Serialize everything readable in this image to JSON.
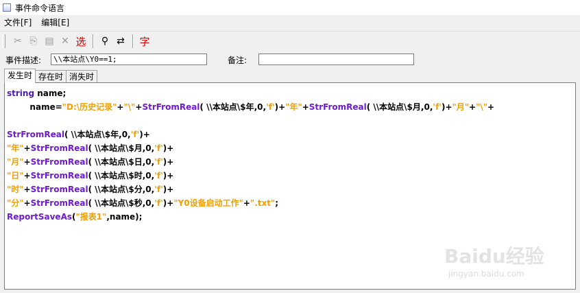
{
  "window": {
    "title": "事件命令语言"
  },
  "menu": {
    "items": [
      "文件[F]",
      "编辑[E]"
    ]
  },
  "toolbar": {
    "buttons": [
      {
        "icon": "cut-icon",
        "glyph": "✂",
        "enabled": false
      },
      {
        "icon": "copy-icon",
        "glyph": "⎘",
        "enabled": false
      },
      {
        "icon": "paste-icon",
        "glyph": "▤",
        "enabled": false
      },
      {
        "icon": "delete-icon",
        "glyph": "✕",
        "enabled": false
      },
      {
        "icon": "select-text",
        "glyph": "选",
        "enabled": true
      },
      {
        "icon": "find-binoculars-icon",
        "glyph": "⚲",
        "enabled": true
      },
      {
        "icon": "replace-icon",
        "glyph": "⇄",
        "enabled": true
      },
      {
        "icon": "font-text",
        "glyph": "字",
        "enabled": true
      }
    ]
  },
  "fields": {
    "event_desc_label": "事件描述:",
    "event_desc_value": "\\\\本站点\\Y0==1;",
    "remark_label": "备注:",
    "remark_value": ""
  },
  "tabs": [
    "发生时",
    "存在时",
    "消失时"
  ],
  "active_tab": 0,
  "code": [
    [
      [
        "kw",
        "string"
      ],
      [
        "id",
        " name;"
      ]
    ],
    [
      [
        "id",
        "        name="
      ],
      [
        "str",
        "\"D:\\历史记录\""
      ],
      [
        "op",
        "+"
      ],
      [
        "str",
        "\"\\\""
      ],
      [
        "op",
        "+"
      ],
      [
        "fn",
        "StrFromReal"
      ],
      [
        "id",
        "( \\\\本站点\\$年,0,"
      ],
      [
        "str",
        "'f'"
      ],
      [
        "id",
        ")+"
      ],
      [
        "str",
        "\"年\""
      ],
      [
        "op",
        "+"
      ],
      [
        "fn",
        "StrFromReal"
      ],
      [
        "id",
        "( \\\\本站点\\$月,0,"
      ],
      [
        "str",
        "'f'"
      ],
      [
        "id",
        ")+"
      ],
      [
        "str",
        "\"月\""
      ],
      [
        "op",
        "+"
      ],
      [
        "str",
        "\"\\\""
      ],
      [
        "op",
        "+"
      ]
    ],
    [],
    [
      [
        "fn",
        "StrFromReal"
      ],
      [
        "id",
        "( \\\\本站点\\$年,0,"
      ],
      [
        "str",
        "'f'"
      ],
      [
        "id",
        ")+"
      ]
    ],
    [
      [
        "str",
        "\"年\""
      ],
      [
        "op",
        "+"
      ],
      [
        "fn",
        "StrFromReal"
      ],
      [
        "id",
        "( \\\\本站点\\$月,0,"
      ],
      [
        "str",
        "'f'"
      ],
      [
        "id",
        ")+"
      ]
    ],
    [
      [
        "str",
        "\"月\""
      ],
      [
        "op",
        "+"
      ],
      [
        "fn",
        "StrFromReal"
      ],
      [
        "id",
        "( \\\\本站点\\$日,0,"
      ],
      [
        "str",
        "'f'"
      ],
      [
        "id",
        ")+"
      ]
    ],
    [
      [
        "str",
        "\"日\""
      ],
      [
        "op",
        "+"
      ],
      [
        "fn",
        "StrFromReal"
      ],
      [
        "id",
        "( \\\\本站点\\$时,0,"
      ],
      [
        "str",
        "'f'"
      ],
      [
        "id",
        ")+"
      ]
    ],
    [
      [
        "str",
        "\"时\""
      ],
      [
        "op",
        "+"
      ],
      [
        "fn",
        "StrFromReal"
      ],
      [
        "id",
        "( \\\\本站点\\$分,0,"
      ],
      [
        "str",
        "'f'"
      ],
      [
        "id",
        ")+"
      ]
    ],
    [
      [
        "str",
        "\"分\""
      ],
      [
        "op",
        "+"
      ],
      [
        "fn",
        "StrFromReal"
      ],
      [
        "id",
        "( \\\\本站点\\$秒,0,"
      ],
      [
        "str",
        "'f'"
      ],
      [
        "id",
        ")+"
      ],
      [
        "str",
        "\"Y0设备启动工作\""
      ],
      [
        "op",
        "+"
      ],
      [
        "str",
        "\".txt\""
      ],
      [
        "id",
        ";"
      ]
    ],
    [
      [
        "fn",
        "ReportSaveAs"
      ],
      [
        "id",
        "("
      ],
      [
        "str",
        "\"报表1\""
      ],
      [
        "id",
        ",name);"
      ]
    ]
  ],
  "watermark": {
    "main": "Baidu经验",
    "sub": "jingyan.baidu.com"
  },
  "colors": {
    "keyword": "#4b1bb6",
    "function": "#6f1bd0",
    "string": "#f0a000"
  }
}
